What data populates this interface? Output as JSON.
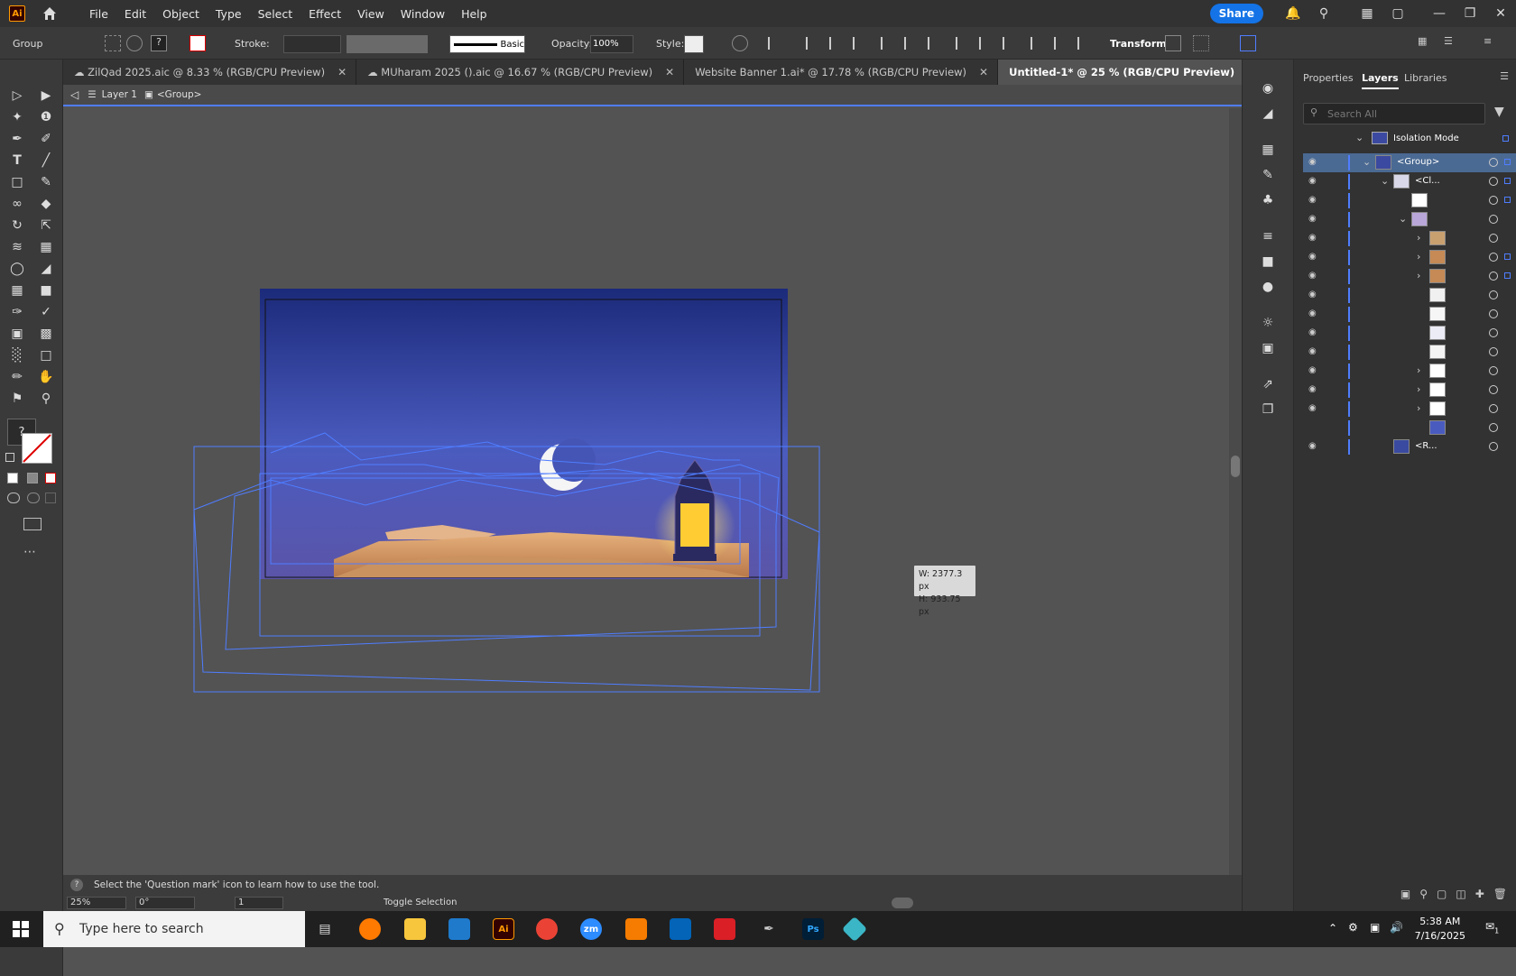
{
  "app": {
    "logo": "Ai",
    "menus": [
      "File",
      "Edit",
      "Object",
      "Type",
      "Select",
      "Effect",
      "View",
      "Window",
      "Help"
    ],
    "share": "Share"
  },
  "control": {
    "selection": "Group",
    "stroke_label": "Stroke:",
    "brush": "Basic",
    "opacity_label": "Opacity:",
    "opacity_value": "100%",
    "style_label": "Style:",
    "transform": "Transform"
  },
  "tabs": [
    {
      "label": "ZilQad 2025.aic @ 8.33 % (RGB/CPU Preview)",
      "cloud": true
    },
    {
      "label": "MUharam 2025 ().aic @ 16.67 % (RGB/CPU Preview)",
      "cloud": true
    },
    {
      "label": "Website Banner 1.ai* @ 17.78 % (RGB/CPU Preview)",
      "cloud": false
    },
    {
      "label": "Untitled-1* @ 25 % (RGB/CPU Preview)",
      "cloud": false
    }
  ],
  "crumb": {
    "layer": "Layer 1",
    "group": "<Group>"
  },
  "canvas": {
    "dims_w": "W: 2377.3 px",
    "dims_h": "H: 933.75 px"
  },
  "status": {
    "help": "Select the 'Question mark' icon to learn how to use the tool.",
    "zoom": "25%",
    "rotation": "0°",
    "artboard": "1",
    "mode": "Toggle Selection"
  },
  "panel": {
    "tabs": [
      "Properties",
      "Layers",
      "Libraries"
    ],
    "search_placeholder": "Search All",
    "isolation": "Isolation Mode",
    "rows": [
      {
        "name": "<Group>",
        "level": 1,
        "chev": "down",
        "sel": true
      },
      {
        "name": "<Cl...",
        "level": 2,
        "chev": "down"
      },
      {
        "name": "",
        "level": 3,
        "chev": ""
      },
      {
        "name": "",
        "level": 3,
        "chev": "down"
      },
      {
        "name": "",
        "level": 4,
        "chev": "right"
      },
      {
        "name": "",
        "level": 4,
        "chev": "right"
      },
      {
        "name": "",
        "level": 4,
        "chev": "right"
      },
      {
        "name": "",
        "level": 4,
        "chev": ""
      },
      {
        "name": "",
        "level": 4,
        "chev": ""
      },
      {
        "name": "",
        "level": 4,
        "chev": ""
      },
      {
        "name": "",
        "level": 4,
        "chev": ""
      },
      {
        "name": "",
        "level": 4,
        "chev": "right"
      },
      {
        "name": "",
        "level": 4,
        "chev": "right"
      },
      {
        "name": "",
        "level": 4,
        "chev": "right"
      },
      {
        "name": "",
        "level": 4,
        "chev": "",
        "noeye": true
      },
      {
        "name": "<R...",
        "level": 2,
        "chev": ""
      }
    ]
  },
  "taskbar": {
    "search": "Type here to search",
    "time": "5:38 AM",
    "date": "7/16/2025",
    "notif": "1"
  }
}
